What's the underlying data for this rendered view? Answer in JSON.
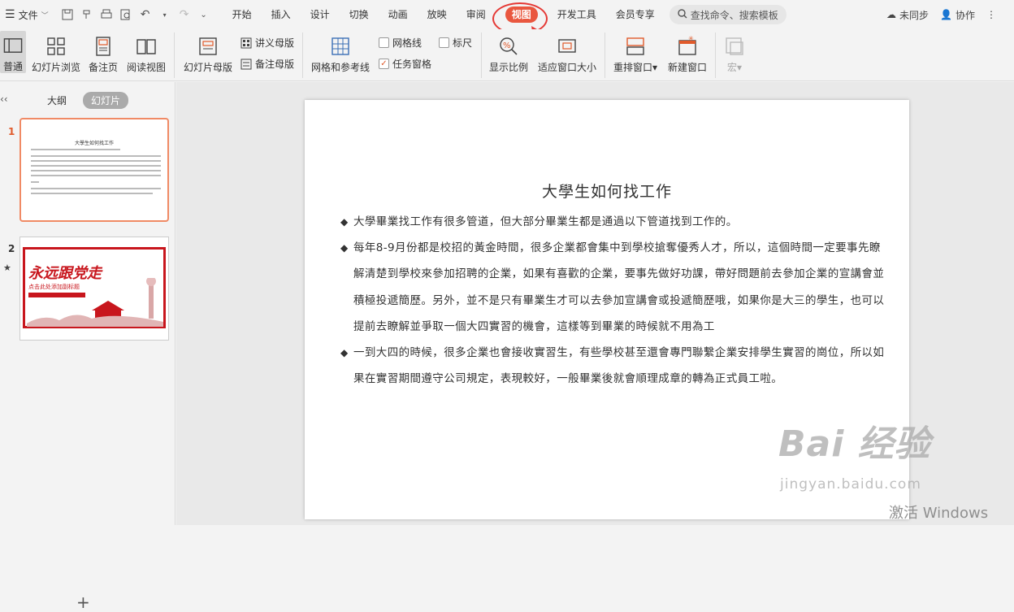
{
  "menu": {
    "file_label": "文件"
  },
  "tabs": [
    "开始",
    "插入",
    "设计",
    "切换",
    "动画",
    "放映",
    "审阅",
    "视图",
    "开发工具",
    "会员专享"
  ],
  "active_tab": "视图",
  "search": {
    "placeholder": "查找命令、搜索模板"
  },
  "top_right": {
    "sync": "未同步",
    "collab": "协作"
  },
  "ribbon": {
    "normal": "普通",
    "slide_sorter": "幻灯片浏览",
    "notes_page": "备注页",
    "reading_view": "阅读视图",
    "slide_master": "幻灯片母版",
    "handout_master": "讲义母版",
    "notes_master": "备注母版",
    "grid_guides": "网格和参考线",
    "gridlines": "网格线",
    "ruler": "标尺",
    "task_pane": "任务窗格",
    "zoom": "显示比例",
    "fit_window": "适应窗口大小",
    "arrange": "重排窗口",
    "new_window": "新建窗口",
    "macro": "宏"
  },
  "panel": {
    "outline": "大纲",
    "slides": "幻灯片"
  },
  "thumbnails": [
    {
      "number": "1",
      "title": "大學生如何找工作"
    },
    {
      "number": "2",
      "title": "永远跟党走",
      "subtitle": "点击此处添加副标题",
      "accent": "#c8161d"
    }
  ],
  "slide": {
    "title": "大學生如何找工作",
    "bullets": [
      "大學畢業找工作有很多管道，但大部分畢業生都是通過以下管道找到工作的。",
      "每年8-9月份都是校招的黃金時間，很多企業都會集中到學校搶奪優秀人才，所以，這個時間一定要事先瞭解清楚到學校來參加招聘的企業，如果有喜歡的企業，要事先做好功課，帶好問題前去參加企業的宣講會並積極投遞簡歷。另外，並不是只有畢業生才可以去參加宣講會或投遞簡歷哦，如果你是大三的學生，也可以提前去瞭解並爭取一個大四實習的機會，這樣等到畢業的時候就不用為工",
      "一到大四的時候，很多企業也會接收實習生，有些學校甚至還會專門聯繫企業安排學生實習的崗位，所以如果在實習期間遵守公司規定，表現較好，一般畢業後就會順理成章的轉為正式員工啦。"
    ]
  },
  "watermark": {
    "logo": "Bai 经验",
    "url": "jingyan.baidu.com"
  },
  "activate": "激活 Windows",
  "colors": {
    "accent": "#e9573f",
    "annotation": "#e53935"
  }
}
